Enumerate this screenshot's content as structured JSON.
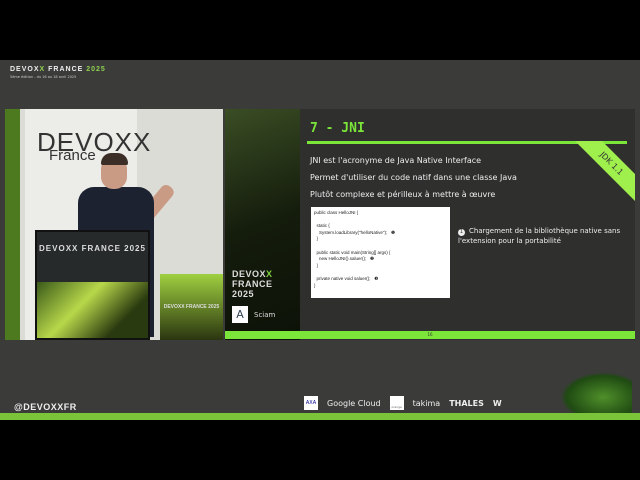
{
  "header": {
    "brand": "DEVOX",
    "brand_x": "X",
    "brand_rest": " FRANCE ",
    "brand_year": "2025",
    "subtitle": "5ème édition - du 16 au 18 avril 2025"
  },
  "camera": {
    "banner_brand": "DEVOXX",
    "banner_sub": "France",
    "podium_text": "DEVOXX FRANCE 2025",
    "screen_text": "DEVOXX FRANCE 2025"
  },
  "slide": {
    "side_line1": "DEVOX",
    "side_x": "X",
    "side_line2": "FRANCE",
    "side_line3": "2025",
    "company": "Sciam",
    "title": "7 - JNI",
    "badge": "JDK 1.1",
    "bullets": [
      "JNI est l'acronyme de Java Native Interface",
      "Permet d'utiliser du code natif dans une classe Java",
      "Plutôt complexe et périlleux à mettre à œuvre"
    ],
    "code": "public class HelloJNI {\n\n  static {\n    System.loadLibrary(\"helloNative\");   ❶\n  }\n\n  public static void main(String[] args) {\n    new HelloJNI().saluer();   ❷\n  }\n\n  private native void saluer();   ❸\n}",
    "note_num": "1",
    "note": "Chargement de la bibliothèque native sans l'extension pour la portabilité",
    "page": "16"
  },
  "footer": {
    "handle": "@DEVOXXFR",
    "sponsors": [
      "AXA",
      "Google Cloud",
      "orange",
      "takima",
      "THALES",
      "W"
    ]
  },
  "colors": {
    "accent": "#7be53a",
    "background": "#3b3b3a"
  }
}
